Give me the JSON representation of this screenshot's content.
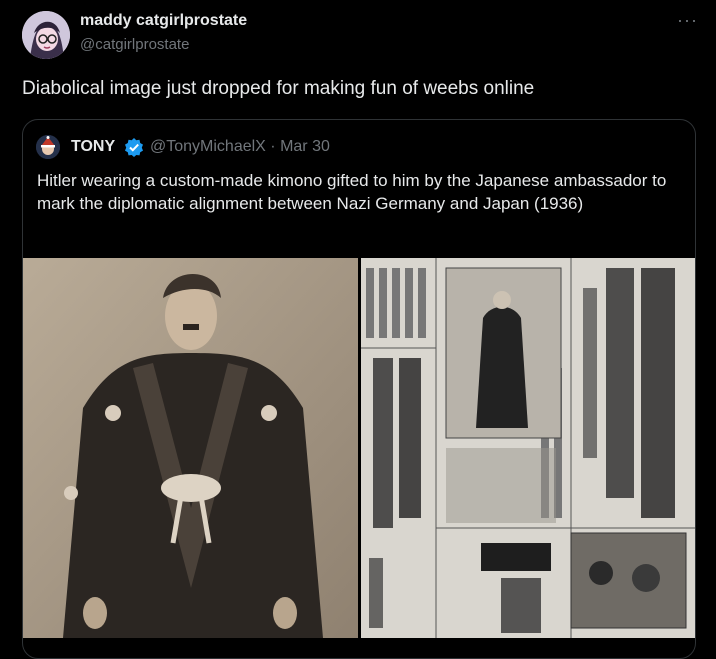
{
  "author": {
    "name": "maddy catgirlprostate",
    "handle": "@catgirlprostate"
  },
  "menu_icon": "more-horizontal-icon",
  "tweet": {
    "text": "Diabolical image just dropped for making fun of weebs online"
  },
  "quoted": {
    "name": "TONY",
    "handle_date": "@TonyMichaelX · Mar 30",
    "verified_color": "#1d9bf0",
    "text": "Hitler wearing a custom-made kimono gifted to him by the Japanese ambassador to mark the diplomatic alignment between Nazi Germany and Japan (1936)"
  },
  "colors": {
    "background": "#000000",
    "text": "#e7e9ea",
    "secondary": "#71767b",
    "border": "#2f3336"
  }
}
